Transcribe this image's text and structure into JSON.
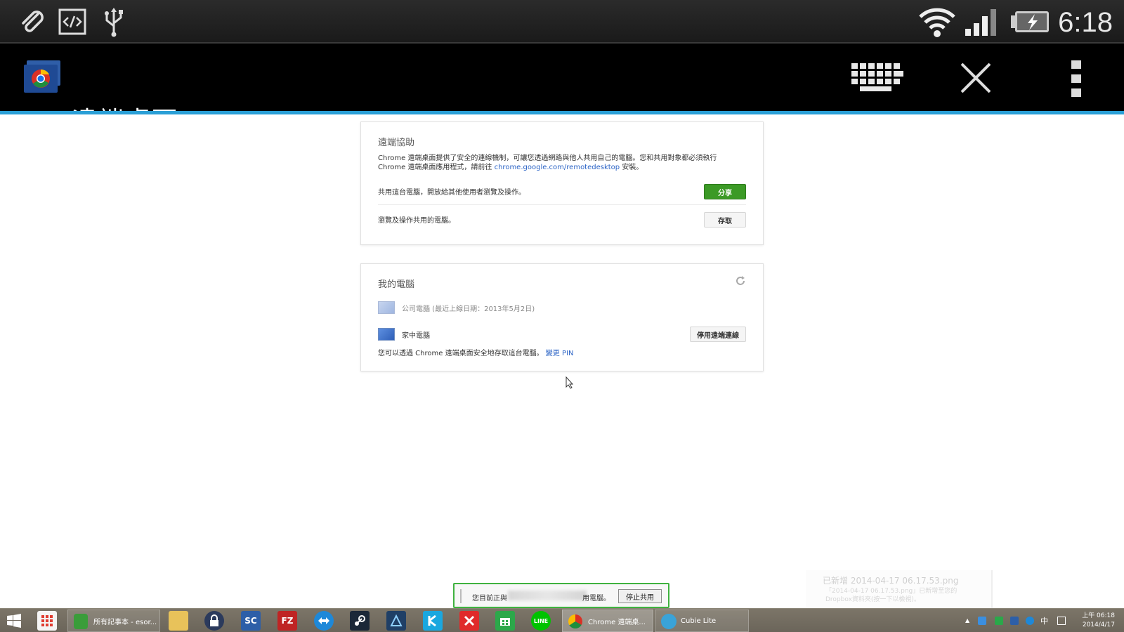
{
  "status_bar": {
    "time": "6:18",
    "icons": [
      "paperclip-icon",
      "code-icon",
      "usb-icon",
      "wifi-icon",
      "signal-icon",
      "battery-charging-icon"
    ]
  },
  "action_bar": {
    "title": "遠端桌面",
    "icons": [
      "chrome-remote-desktop-app-icon",
      "keyboard-icon",
      "close-icon",
      "overflow-menu-icon"
    ]
  },
  "remote_assist": {
    "title": "遠端協助",
    "description_line1": "Chrome 遠端桌面提供了安全的連線機制，可讓您透過網路與他人共用自己的電腦。您和共用對象都必須執行",
    "description_line2_prefix": "Chrome 遠端桌面應用程式，請前往 ",
    "description_link": "chrome.google.com/remotedesktop",
    "description_line2_suffix": " 安裝。",
    "share_text": "共用這台電腦，開放給其他使用者瀏覽及操作。",
    "share_button": "分享",
    "access_text": "瀏覽及操作共用的電腦。",
    "access_button": "存取"
  },
  "my_computers": {
    "title": "我的電腦",
    "refresh_icon": "refresh-icon",
    "computers": [
      {
        "name": "公司電腦 (最近上線日期：2013年5月2日)",
        "online": false
      },
      {
        "name": "家中電腦",
        "online": true
      }
    ],
    "disable_button": "停用遠端連線",
    "footer_prefix": "您可以透過 Chrome 遠端桌面安全地存取這台電腦。",
    "footer_link": "變更 PIN"
  },
  "share_bar": {
    "text_prefix": "您目前正與",
    "text_suffix": "用電腦。",
    "stop_button": "停止共用"
  },
  "toast": {
    "title": "已新增 2014-04-17 06.17.53.png",
    "body": "「2014-04-17 06.17.53.png」已新增至您的 Dropbox資料夾(按一下以檢視)。"
  },
  "taskbar": {
    "tasks": [
      {
        "label": "所有記事本 - esor...",
        "icon": "evernote-icon"
      },
      {
        "label": "Chrome 遠端桌...",
        "icon": "chrome-icon"
      },
      {
        "label": "Cubie Lite",
        "icon": "cubie-icon"
      }
    ],
    "pinned_icons": [
      "windows-start-icon",
      "apps-grid-icon",
      "file-explorer-icon",
      "keepass-icon",
      "sc-icon",
      "filezilla-icon",
      "teamviewer-icon",
      "steam-icon",
      "app-icon",
      "kodi-icon",
      "xmind-icon",
      "store-icon",
      "line-icon"
    ],
    "pinned_labels": {
      "sc": "SC",
      "fz": "FZ",
      "line": "LINE"
    },
    "tray_ime": "中",
    "tray_time": "上午 06:18",
    "tray_date": "2014/4/17"
  },
  "colors": {
    "accent_blue": "#2a9fd6",
    "share_green": "#3c9a26",
    "link_blue": "#2962c5"
  }
}
